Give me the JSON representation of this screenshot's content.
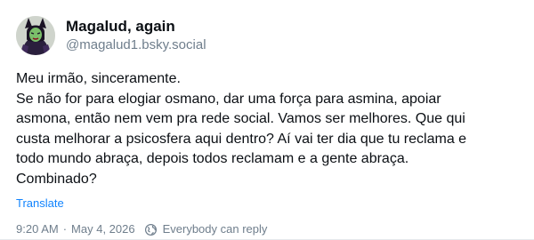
{
  "post": {
    "author": {
      "display_name": "Magalud, again",
      "handle": "@magalud1.bsky.social",
      "avatar_icon": "villain-avatar-icon"
    },
    "text_lines": [
      "Meu irmão, sinceramente.",
      "Se não for para elogiar osmano, dar uma força para asmina, apoiar",
      "asmona, então nem vem pra rede social. Vamos ser melhores. Que qui",
      "custa melhorar a psicosfera aqui dentro? Aí vai ter dia que tu reclama e",
      "todo mundo abraça, depois todos reclamam e a gente abraça.",
      "Combinado?"
    ],
    "translate_label": "Translate",
    "timestamp": "9:20 AM",
    "separator": "·",
    "date": "May 4, 2026",
    "reply_setting": "Everybody can reply",
    "reply_icon": "globe-icon",
    "colors": {
      "link": "#1083fe",
      "muted": "#6f7e8c",
      "text": "#0b0f14"
    }
  }
}
